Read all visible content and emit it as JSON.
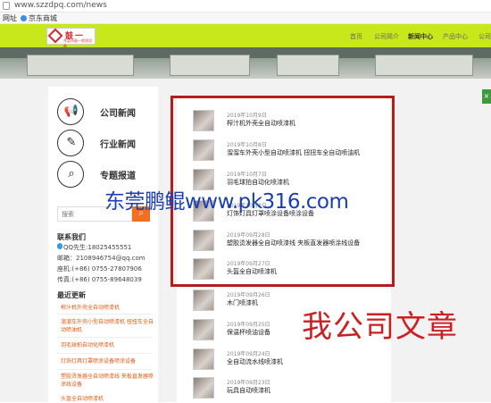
{
  "browser": {
    "url": "www.szzdpq.com/news",
    "bookmarks": [
      "网址",
      "京东商城"
    ]
  },
  "header": {
    "logo_text": "鼓一",
    "logo_sub": "东莞市鼓一喷涂设备",
    "nav": [
      "首页",
      "公司简介",
      "新闻中心",
      "产品中心",
      "公司"
    ],
    "active_nav": "新闻中心",
    "brand_color": "#c8e81c"
  },
  "sidebar": {
    "categories": [
      {
        "label": "公司新闻",
        "icon": "megaphone-icon",
        "glyph": "📢"
      },
      {
        "label": "行业新闻",
        "icon": "brush-icon",
        "glyph": "✎"
      },
      {
        "label": "专题报道",
        "icon": "search-icon",
        "glyph": "⌕"
      }
    ],
    "search_placeholder": "搜索",
    "search_button": "⌕",
    "contact_title": "联系我们",
    "contact_lines": [
      "QQ先生:18025455551",
      "邮箱：2108946754@qq.com",
      "座机:(+86) 0755-27807906",
      "传真:(+86) 0755-89648039"
    ],
    "recent_title": "最近更新",
    "recent_items": [
      "榨汁机外壳全自动喷漆机",
      "溜溜车外壳小型自动喷漆机 扭扭车全自动喷油机",
      "羽毛球拍自动化喷漆机",
      "灯饰灯具灯罩喷涂设备喷涂设备",
      "塑胶烫发器全自动喷漆线 夹板直发器喷涂线设备",
      "头盔全自动喷漆机"
    ]
  },
  "news": [
    {
      "date": "2019年10月9日",
      "title": "榨汁机外壳全自动喷漆机"
    },
    {
      "date": "2019年10月8日",
      "title": "溜溜车外壳小型自动喷漆机 扭扭车全自动喷油机"
    },
    {
      "date": "2019年10月7日",
      "title": "羽毛球拍自动化喷漆机"
    },
    {
      "date": "2019年10月3日",
      "title": "灯饰灯具灯罩喷涂设备喷涂设备"
    },
    {
      "date": "2019年09月28日",
      "title": "塑胶烫发器全自动喷漆线 夹板直发器喷涂线设备"
    },
    {
      "date": "2019年09月27日",
      "title": "头盔全自动喷漆机"
    },
    {
      "date": "2019年09月26日",
      "title": "木门喷漆机"
    },
    {
      "date": "2019年09月25日",
      "title": "保温杯喷油设备"
    },
    {
      "date": "2019年09月24日",
      "title": "全自动流水线喷漆机"
    },
    {
      "date": "2019年09月23日",
      "title": "玩具自动喷漆机"
    }
  ],
  "overlay": {
    "watermark": "东莞鹏鲲www.pk316.com",
    "caption": "我公司文章"
  },
  "side_tab": "×"
}
